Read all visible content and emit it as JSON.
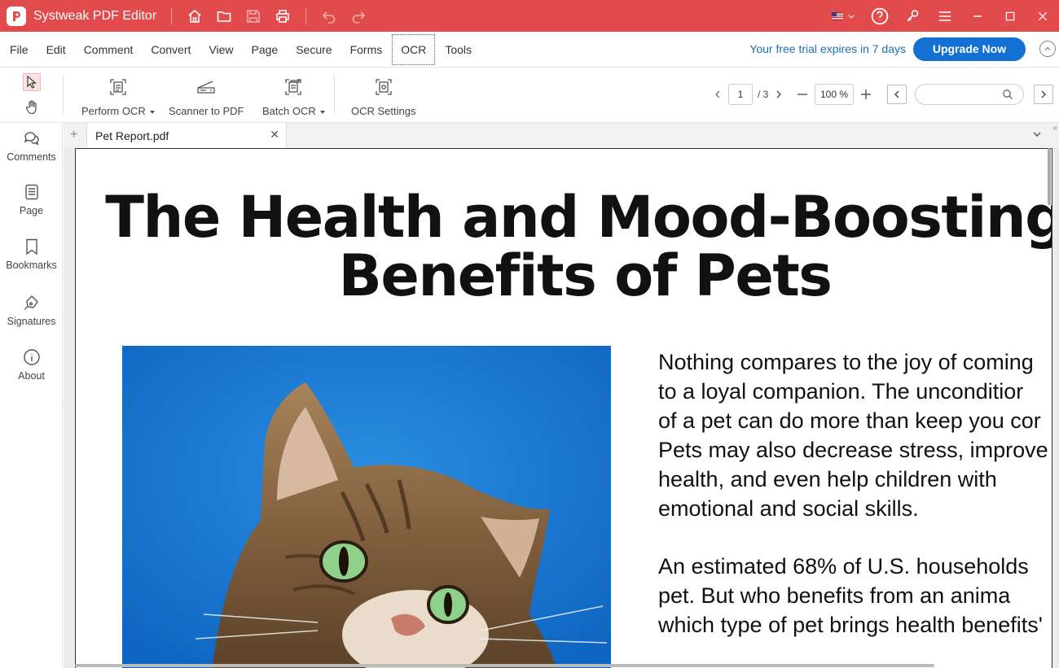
{
  "app": {
    "title": "Systweak PDF Editor",
    "accent_color": "#e14b4b",
    "titlebar_icons": [
      "home-icon",
      "folder-open-icon",
      "save-icon",
      "print-icon",
      "undo-icon",
      "redo-icon"
    ],
    "window_icons": [
      "language-flag-icon",
      "help-icon",
      "key-icon",
      "hamburger-menu-icon",
      "minimize-icon",
      "maximize-icon",
      "close-icon"
    ]
  },
  "menu": {
    "items": [
      "File",
      "Edit",
      "Comment",
      "Convert",
      "View",
      "Page",
      "Secure",
      "Forms",
      "OCR",
      "Tools"
    ],
    "active": "OCR",
    "trial_text": "Your free trial expires in 7 days",
    "upgrade_label": "Upgrade Now",
    "upgrade_color": "#1570d4"
  },
  "ribbon": {
    "buttons": [
      {
        "label": "Perform OCR",
        "icon": "perform-ocr-icon",
        "dropdown": true
      },
      {
        "label": "Scanner to PDF",
        "icon": "scanner-icon",
        "dropdown": false
      },
      {
        "label": "Batch OCR",
        "icon": "batch-ocr-icon",
        "dropdown": true
      },
      {
        "label": "OCR Settings",
        "icon": "ocr-settings-icon",
        "dropdown": false
      }
    ],
    "page_current": "1",
    "page_total": "/ 3",
    "zoom": "100 %",
    "search_value": ""
  },
  "sidebar": {
    "items": [
      {
        "label": "Comments",
        "icon": "comments-icon"
      },
      {
        "label": "Page",
        "icon": "page-icon"
      },
      {
        "label": "Bookmarks",
        "icon": "bookmark-icon"
      },
      {
        "label": "Signatures",
        "icon": "signature-icon"
      },
      {
        "label": "About",
        "icon": "info-icon"
      }
    ]
  },
  "tabs": [
    {
      "title": "Pet Report.pdf"
    }
  ],
  "document": {
    "title_line1": "The Health and Mood-Boosting",
    "title_line2": "Benefits of Pets",
    "paragraph1": [
      "Nothing compares to the joy of coming",
      "to a loyal companion. The unconditior",
      "of a pet can do more than keep you cor",
      "Pets may also decrease stress, improve",
      "health, and even help children with",
      "emotional and social skills."
    ],
    "paragraph2": [
      "An estimated 68% of U.S. households",
      "pet. But who benefits from an anima",
      "which type of pet brings health benefits'"
    ],
    "photo_description_icon": "cat-photo"
  }
}
